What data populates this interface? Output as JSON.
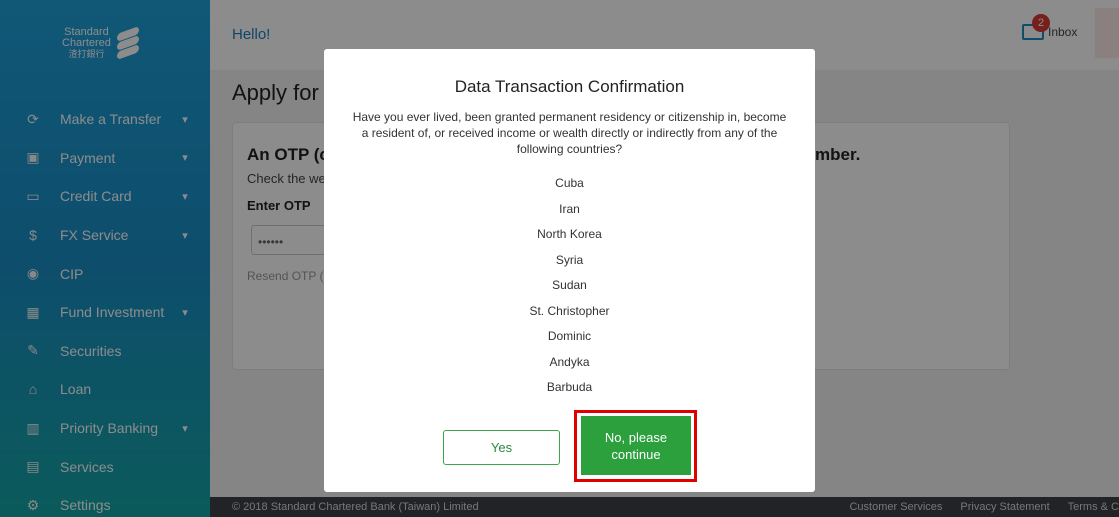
{
  "brand": {
    "line1": "Standard",
    "line2": "Chartered",
    "line3": "渣打銀行"
  },
  "sidebar": {
    "items": [
      {
        "label": "Make a Transfer",
        "icon": "transfer-icon",
        "expandable": true
      },
      {
        "label": "Payment",
        "icon": "payment-icon",
        "expandable": true
      },
      {
        "label": "Credit Card",
        "icon": "credit-card-icon",
        "expandable": true
      },
      {
        "label": "FX Service",
        "icon": "fx-icon",
        "expandable": true
      },
      {
        "label": "CIP",
        "icon": "cip-icon",
        "expandable": false
      },
      {
        "label": "Fund Investment",
        "icon": "fund-icon",
        "expandable": true
      },
      {
        "label": "Securities",
        "icon": "securities-icon",
        "expandable": false
      },
      {
        "label": "Loan",
        "icon": "loan-icon",
        "expandable": false
      },
      {
        "label": "Priority Banking",
        "icon": "priority-icon",
        "expandable": true
      },
      {
        "label": "Services",
        "icon": "services-icon",
        "expandable": false
      },
      {
        "label": "Settings",
        "icon": "settings-icon",
        "expandable": false
      }
    ]
  },
  "header": {
    "greeting": "Hello!",
    "inbox_label": "Inbox",
    "inbox_count": "2"
  },
  "main": {
    "page_title": "Apply for",
    "card_heading": "An OTP (c",
    "card_heading_right": "mber.",
    "check_text": "Check the we",
    "enter_label": "Enter OTP",
    "otp_value": "••••••",
    "resend_text": "Resend OTP ("
  },
  "modal": {
    "title": "Data Transaction Confirmation",
    "question": "Have you ever lived, been granted permanent residency or citizenship in, become a resident of, or received income or wealth directly or indirectly from any of the following countries?",
    "countries": [
      "Cuba",
      "Iran",
      "North Korea",
      "Syria",
      "Sudan",
      "St. Christopher",
      "Dominic",
      "Andyka",
      "Barbuda"
    ],
    "yes_label": "Yes",
    "no_label_line1": "No, please",
    "no_label_line2": "continue"
  },
  "footer": {
    "copyright": "© 2018 Standard Chartered Bank (Taiwan) Limited",
    "links": [
      "Customer Services",
      "Privacy Statement",
      "Terms & C"
    ]
  },
  "colors": {
    "sidebar_top": "#1f9fd8",
    "sidebar_bottom": "#14a5a6",
    "accent_blue": "#1e7fbf",
    "primary_green": "#2ba03d",
    "highlight_red": "#e00000",
    "footer_bg": "#3c4045"
  }
}
